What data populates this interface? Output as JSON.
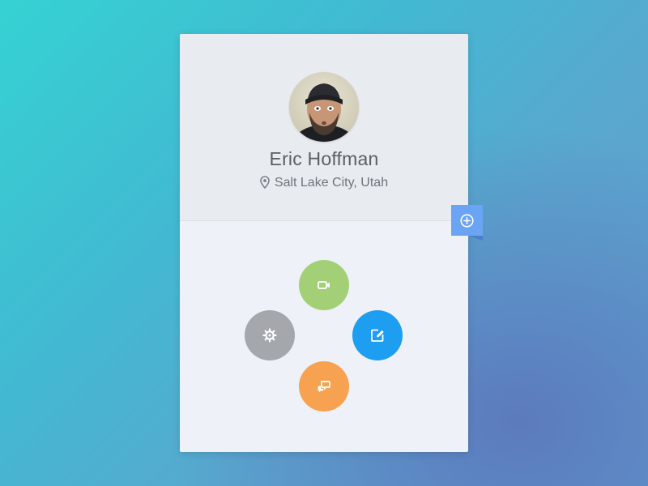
{
  "profile": {
    "name": "Eric Hoffman",
    "location": "Salt Lake City, Utah"
  },
  "icons": {
    "location": "location-pin-icon",
    "add": "plus-circle-icon",
    "video": "video-camera-icon",
    "settings": "gear-icon",
    "edit": "edit-icon",
    "chat": "chat-bubbles-icon"
  },
  "colors": {
    "add_tab": "#6aa4f3",
    "video": "#a3d077",
    "settings": "#a4a7ab",
    "edit": "#1e9ef1",
    "chat": "#f7a250"
  }
}
